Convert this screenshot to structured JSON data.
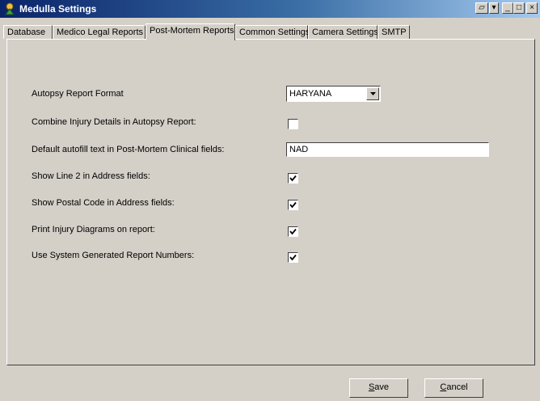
{
  "window": {
    "title": "Medulla Settings",
    "icon": "medulla-app-icon",
    "controls": {
      "restore_alt": "▱",
      "dropdown": "▾",
      "minimize": "_",
      "maximize": "□",
      "close": "×"
    }
  },
  "tabs": [
    {
      "label": "Database",
      "active": false
    },
    {
      "label": "Medico Legal Reports",
      "active": false
    },
    {
      "label": "Post-Mortem Reports",
      "active": true
    },
    {
      "label": "Common Settings",
      "active": false
    },
    {
      "label": "Camera Settings",
      "active": false
    },
    {
      "label": "SMTP",
      "active": false
    }
  ],
  "settings": {
    "autopsy_format": {
      "label": "Autopsy Report Format",
      "value": "HARYANA"
    },
    "combine_injury": {
      "label": "Combine Injury Details in Autopsy Report:",
      "checked": false
    },
    "default_autofill": {
      "label": "Default autofill text in Post-Mortem Clinical fields:",
      "value": "NAD"
    },
    "show_line2": {
      "label": "Show Line 2 in Address fields:",
      "checked": true
    },
    "show_postal": {
      "label": "Show Postal Code in Address fields:",
      "checked": true
    },
    "print_diagrams": {
      "label": "Print Injury Diagrams on report:",
      "checked": true
    },
    "system_numbers": {
      "label": "Use System Generated Report Numbers:",
      "checked": true
    }
  },
  "buttons": {
    "save": {
      "label": "Save",
      "accel": "S",
      "rest": "ave"
    },
    "cancel": {
      "label": "Cancel",
      "accel": "C",
      "rest": "ancel"
    }
  }
}
